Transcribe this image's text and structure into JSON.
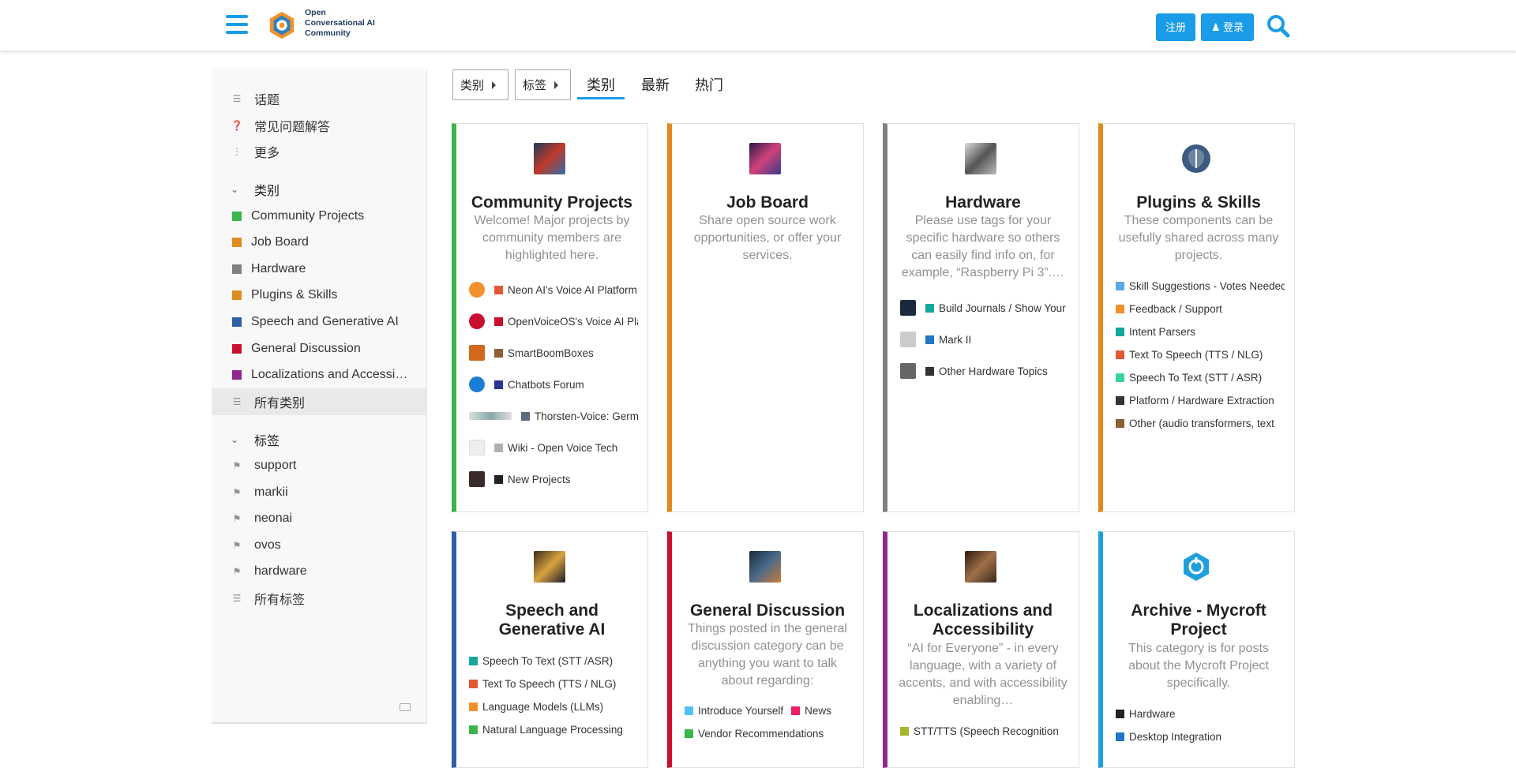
{
  "header": {
    "logo_text": [
      "Open",
      "Conversational AI",
      "Community"
    ],
    "signup_label": "注册",
    "login_label": "登录",
    "accent": "#1b9ce8"
  },
  "sidebar": {
    "links": [
      {
        "label": "话题",
        "icon": "layers-icon"
      },
      {
        "label": "常见问题解答",
        "icon": "question-circle-icon"
      },
      {
        "label": "更多",
        "icon": "ellipsis-vertical-icon"
      }
    ],
    "categories_heading": "类别",
    "categories": [
      {
        "label": "Community Projects",
        "color": "#3ab54a"
      },
      {
        "label": "Job Board",
        "color": "#e08a1e"
      },
      {
        "label": "Hardware",
        "color": "#808281"
      },
      {
        "label": "Plugins & Skills",
        "color": "#e08a1e"
      },
      {
        "label": "Speech and Generative AI",
        "color": "#2d5fa6"
      },
      {
        "label": "General Discussion",
        "color": "#c8102e"
      },
      {
        "label": "Localizations and Accessi…",
        "color": "#92278f"
      }
    ],
    "all_categories": "所有类别",
    "tags_heading": "标签",
    "tags": [
      "support",
      "markii",
      "neonai",
      "ovos",
      "hardware"
    ],
    "all_tags": "所有标签"
  },
  "nav": {
    "category_drop": "类别",
    "tag_drop": "标签",
    "tabs": [
      "类别",
      "最新",
      "热门"
    ]
  },
  "cards": [
    {
      "title": "Community Projects",
      "color": "#3ab54a",
      "desc": "Welcome! Major projects by community members are highlighted here.",
      "subs": [
        {
          "label": "Neon AI's Voice AI Platform",
          "color": "#e45735"
        },
        {
          "label": "OpenVoiceOS's Voice AI Platform",
          "color": "#c8102e"
        },
        {
          "label": "SmartBoomBoxes",
          "color": "#8b5e34"
        },
        {
          "label": "Chatbots Forum",
          "color": "#283593"
        },
        {
          "label": "Thorsten-Voice: German",
          "color": "#5c6a82"
        },
        {
          "label": "Wiki - Open Voice Tech",
          "color": "#b0b0b0"
        },
        {
          "label": "New Projects",
          "color": "#222222"
        }
      ]
    },
    {
      "title": "Job Board",
      "color": "#e08a1e",
      "desc": "Share open source work opportunities, or offer your services.",
      "subs": []
    },
    {
      "title": "Hardware",
      "color": "#808281",
      "desc": "Please use tags for your specific hardware so others can easily find info on, for example, “Raspberry Pi 3”.…",
      "subs": [
        {
          "label": "Build Journals / Show Your",
          "color": "#12a89d"
        },
        {
          "label": "Mark II",
          "color": "#2176c7"
        },
        {
          "label": "Other Hardware Topics",
          "color": "#333333"
        }
      ]
    },
    {
      "title": "Plugins & Skills",
      "color": "#e08a1e",
      "desc": "These components can be usefully shared across many projects.",
      "subs": [
        {
          "label": "Skill Suggestions - Votes Needed",
          "color": "#5aa9e6"
        },
        {
          "label": "Feedback / Support",
          "color": "#f1912c"
        },
        {
          "label": "Intent Parsers",
          "color": "#12a89d"
        },
        {
          "label": "Text To Speech (TTS / NLG)",
          "color": "#e45735"
        },
        {
          "label": "Speech To Text (STT / ASR)",
          "color": "#3ad29f"
        },
        {
          "label": "Platform / Hardware Extraction",
          "color": "#333333"
        },
        {
          "label": "Other (audio transformers, text",
          "color": "#8b5e34"
        }
      ]
    },
    {
      "title": "Speech and Generative AI",
      "color": "#2d5fa6",
      "desc": "",
      "subs": [
        {
          "label": "Speech To Text (STT /ASR)",
          "color": "#12a89d"
        },
        {
          "label": "Text To Speech (TTS / NLG)",
          "color": "#e45735"
        },
        {
          "label": "Language Models (LLMs)",
          "color": "#f1912c"
        },
        {
          "label": "Natural Language Processing",
          "color": "#3ab54a"
        }
      ]
    },
    {
      "title": "General Discussion",
      "color": "#c8102e",
      "desc": "Things posted in the general discussion category can be anything you want to talk about regarding:",
      "subs_inline": [
        [
          {
            "label": "Introduce Yourself",
            "color": "#4fc3f7"
          },
          {
            "label": "News",
            "color": "#e91e63"
          }
        ],
        [
          {
            "label": "Vendor Recommendations",
            "color": "#3ab54a"
          }
        ]
      ]
    },
    {
      "title": "Localizations and Accessibility",
      "color": "#92278f",
      "desc": "“AI for Everyone” - in every language, with a variety of accents, and with accessibility enabling…",
      "subs": [
        {
          "label": "STT/TTS (Speech Recognition",
          "color": "#a4b62a"
        }
      ]
    },
    {
      "title": "Archive - Mycroft Project",
      "color": "#1ea0dc",
      "desc": "This category is for posts about the Mycroft Project specifically.",
      "subs": [
        {
          "label": "Hardware",
          "color": "#222222"
        },
        {
          "label": "Desktop Integration",
          "color": "#2176c7"
        }
      ]
    }
  ]
}
